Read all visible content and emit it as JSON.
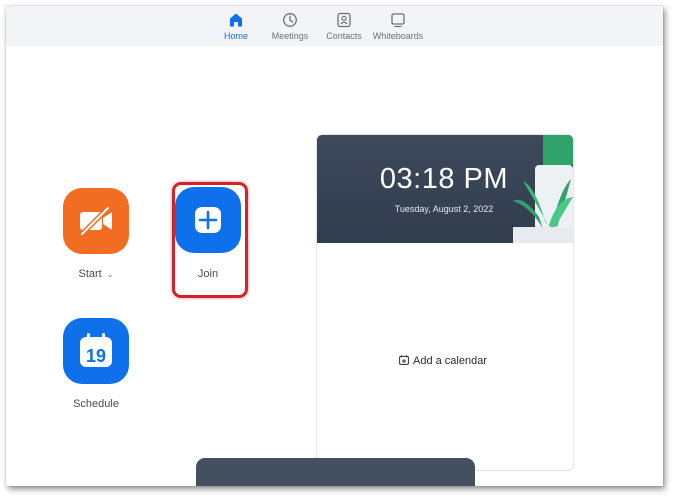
{
  "nav": {
    "items": [
      {
        "label": "Home",
        "icon": "home-icon",
        "active": true
      },
      {
        "label": "Meetings",
        "icon": "clock-icon"
      },
      {
        "label": "Contacts",
        "icon": "contacts-icon"
      },
      {
        "label": "Whiteboards",
        "icon": "whiteboard-icon"
      }
    ]
  },
  "actions": {
    "start": {
      "label": "Start",
      "icon": "video-off-icon",
      "color": "#f26d21"
    },
    "join": {
      "label": "Join",
      "icon": "plus-icon",
      "color": "#0e71eb"
    },
    "schedule": {
      "label": "Schedule",
      "icon": "calendar-icon",
      "day": "19",
      "color": "#0e71eb"
    }
  },
  "calendar": {
    "time": "03:18 PM",
    "date": "Tuesday, August 2, 2022",
    "add_label": "Add a calendar"
  },
  "colors": {
    "accent": "#0e71eb",
    "highlight": "#d2232a",
    "header_bg": "#3e4a5c"
  }
}
